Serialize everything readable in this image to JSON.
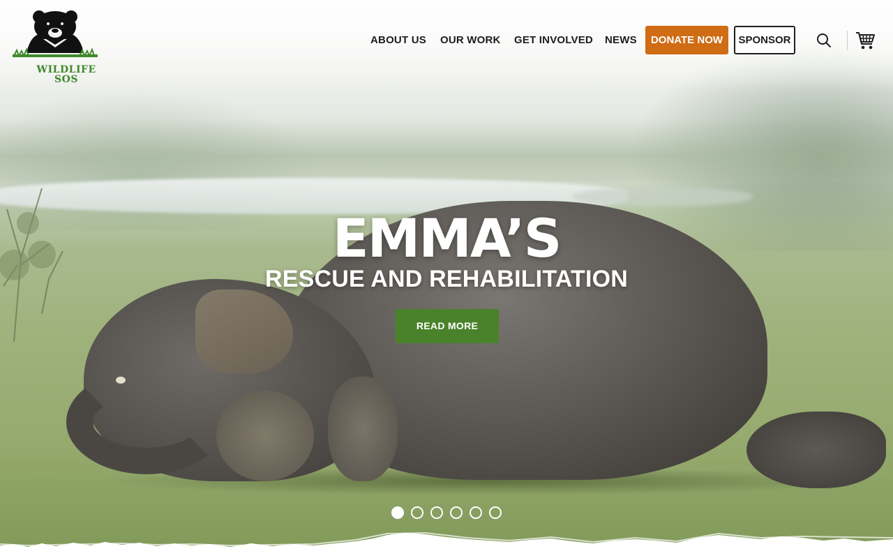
{
  "brand": {
    "logo_text": "WILDLIFE SOS",
    "logo_icon": "sloth-bear-logo",
    "brand_green": "#3f8a2c"
  },
  "nav": {
    "items": [
      {
        "label": "ABOUT US"
      },
      {
        "label": "OUR WORK"
      },
      {
        "label": "GET INVOLVED"
      },
      {
        "label": "NEWS"
      }
    ],
    "donate_label": "DONATE NOW",
    "donate_color": "#cf6c14",
    "sponsor_label": "SPONSOR",
    "search_icon": "search-icon",
    "cart_icon": "cart-icon"
  },
  "hero": {
    "title": "EMMA’S",
    "subtitle": "RESCUE AND REHABILITATION",
    "cta_label": "READ MORE",
    "cta_color": "#4a822b",
    "slide_count": 6,
    "active_slide": 1
  }
}
